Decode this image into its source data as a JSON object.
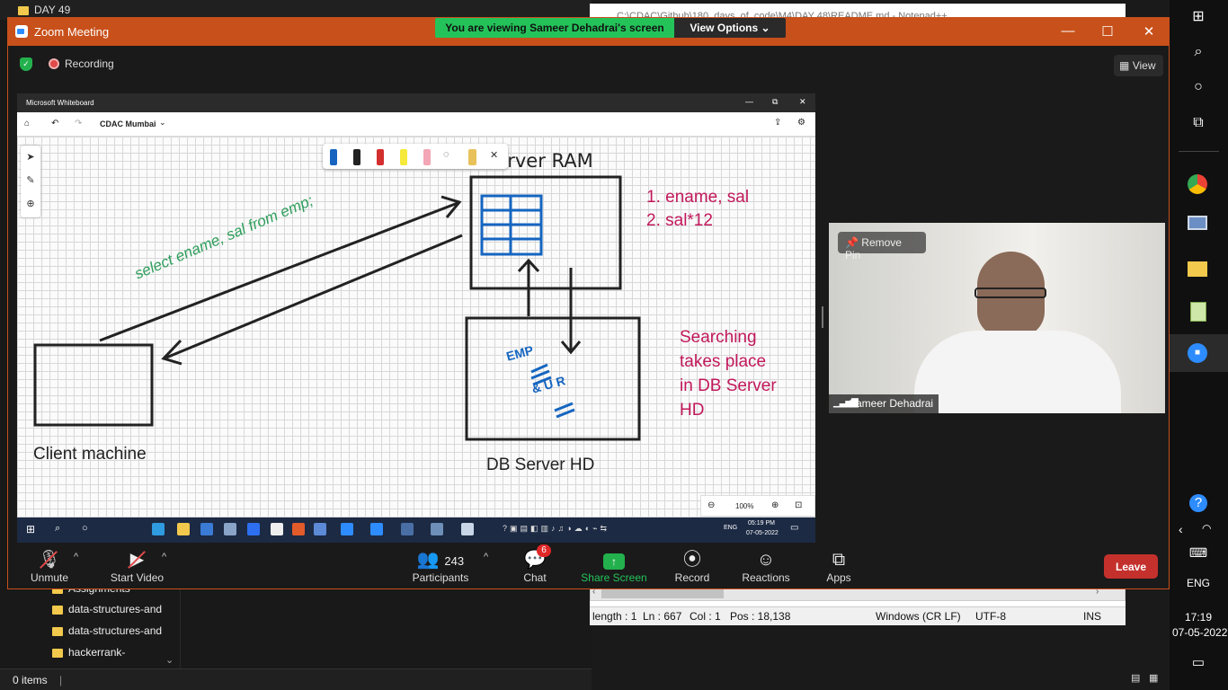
{
  "explorer": {
    "window_title": "DAY 49",
    "items": [
      "Assignments",
      "data-structures-and",
      "data-structures-and",
      "hackerrank-"
    ],
    "status": "0 items"
  },
  "notepad": {
    "title": "C:\\CDAC\\Github\\180_days_of_code\\M4\\DAY 48\\README.md - Notepad++",
    "length": "length : 1",
    "ln": "Ln : 667",
    "col": "Col : 1",
    "pos": "Pos : 18,138",
    "eol": "Windows (CR LF)",
    "encoding": "UTF-8",
    "mode": "INS"
  },
  "zoom": {
    "title": "Zoom Meeting",
    "banner": "You are viewing Sameer Dehadrai's screen",
    "view_options": "View Options",
    "recording": "Recording",
    "view_button": "View",
    "remove_pin": "Remove Pin",
    "participant_name": "Sameer Dehadrai",
    "controls": {
      "unmute": "Unmute",
      "start_video": "Start Video",
      "participants": "Participants",
      "participants_count": "243",
      "chat": "Chat",
      "chat_badge": "6",
      "share_screen": "Share Screen",
      "record": "Record",
      "reactions": "Reactions",
      "apps": "Apps",
      "leave": "Leave"
    }
  },
  "whiteboard": {
    "app_title": "Microsoft Whiteboard",
    "board_name": "CDAC Mumbai",
    "zoom_level": "100%",
    "labels": {
      "server_ram": "Server RAM",
      "query": "select ename, sal from emp;",
      "list1": "1. ename, sal",
      "list2": "2. sal*12",
      "client": "Client machine",
      "db_server": "DB Server HD",
      "note1": "Searching",
      "note2": "takes place",
      "note3": "in DB Server",
      "note4": "HD",
      "scribble1": "EMP",
      "scribble2": "& U R"
    },
    "inner_taskbar": {
      "time": "05:19 PM",
      "date": "07-05-2022",
      "lang": "ENG"
    }
  },
  "system": {
    "time": "17:19",
    "date": "07-05-2022",
    "lang": "ENG"
  },
  "colors": {
    "zoom_orange": "#c8501a",
    "banner_green": "#24c35a",
    "share_green": "#23b14d",
    "leave_red": "#c4312d",
    "ink_pink": "#c2185b",
    "ink_green": "#2e9e5b",
    "ink_blue": "#1565c0"
  }
}
